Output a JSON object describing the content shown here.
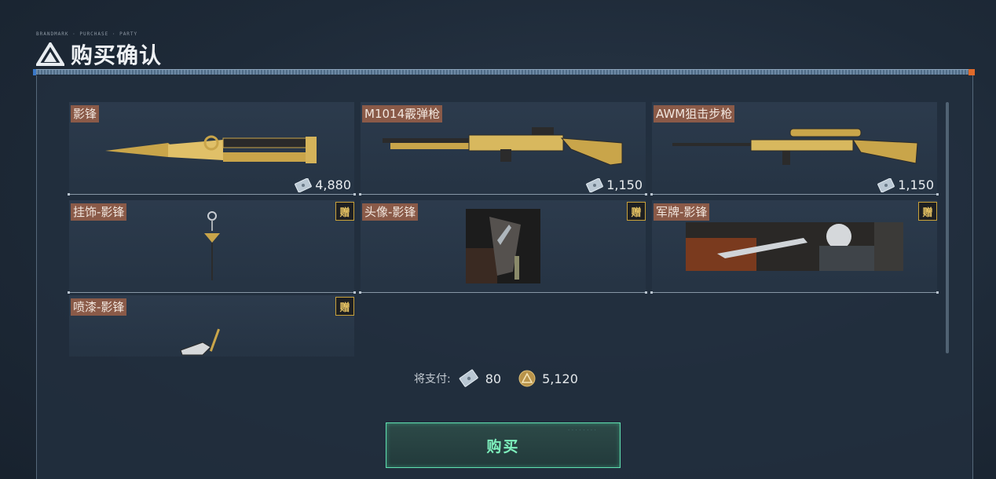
{
  "header": {
    "tiny_text": "BRANDMARK · PURCHASE · PARTY",
    "title": "购买确认"
  },
  "items": [
    {
      "name": "影锋",
      "price": "4,880",
      "gift": ""
    },
    {
      "name": "M1014霰弹枪",
      "price": "1,150",
      "gift": ""
    },
    {
      "name": "AWM狙击步枪",
      "price": "1,150",
      "gift": ""
    },
    {
      "name": "挂饰-影锋",
      "price": "",
      "gift": "赠"
    },
    {
      "name": "头像-影锋",
      "price": "",
      "gift": "赠"
    },
    {
      "name": "军牌-影锋",
      "price": "",
      "gift": "赠"
    },
    {
      "name": "喷漆-影锋",
      "price": "",
      "gift": "赠"
    }
  ],
  "payment": {
    "label": "将支付:",
    "ticket_amount": "80",
    "coin_amount": "5,120"
  },
  "buy_button": {
    "label": "购买"
  },
  "colors": {
    "name_tag": "#8a5a48",
    "gift_border": "#c9a23a",
    "buy_border": "#5fe0b0",
    "buy_text": "#7ef0bd"
  },
  "icons": [
    "triangle-logo-icon",
    "ticket-icon",
    "gold-coin-icon"
  ]
}
